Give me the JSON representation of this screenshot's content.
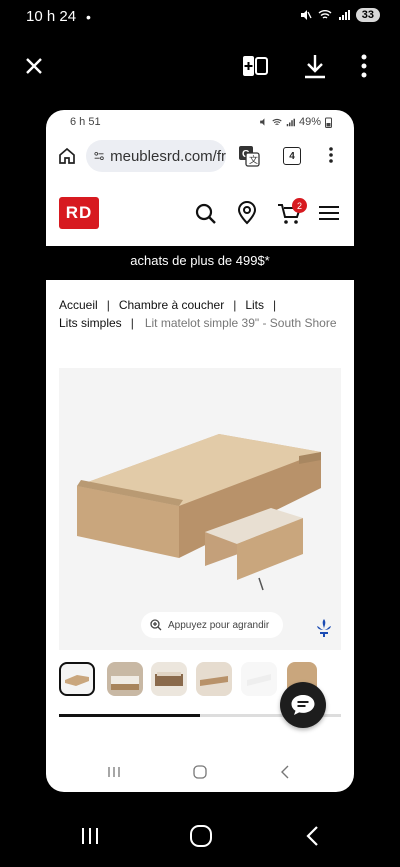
{
  "outer_status": {
    "time": "10 h 24",
    "dot": "•",
    "battery": "33"
  },
  "inner_status": {
    "time": "6 h 51",
    "battery": "49%"
  },
  "browser": {
    "url": "meublesrd.com/fr",
    "tab_count": "4"
  },
  "site": {
    "logo": "RD",
    "cart_count": "2",
    "promo_text": "achats de plus de 499$*"
  },
  "breadcrumbs": {
    "home": "Accueil",
    "bedroom": "Chambre à coucher",
    "beds": "Lits",
    "single_beds": "Lits simples",
    "current": "Lit matelot simple 39\" - South Shore"
  },
  "product": {
    "zoom_hint": "Appuyez pour agrandir"
  },
  "icons": [
    "close-icon",
    "compare-icon",
    "download-icon",
    "more-icon",
    "home-icon",
    "site-settings-icon",
    "translate-icon",
    "tabs-icon",
    "search-icon",
    "location-icon",
    "cart-icon",
    "menu-icon",
    "zoom-icon",
    "fleur-de-lis-icon",
    "chat-icon",
    "recents-icon",
    "home-nav-icon",
    "back-icon"
  ],
  "colors": {
    "brand_red": "#d71a20",
    "background": "#000000",
    "card": "#ffffff"
  },
  "gallery": {
    "scroll_progress": 0.5
  }
}
